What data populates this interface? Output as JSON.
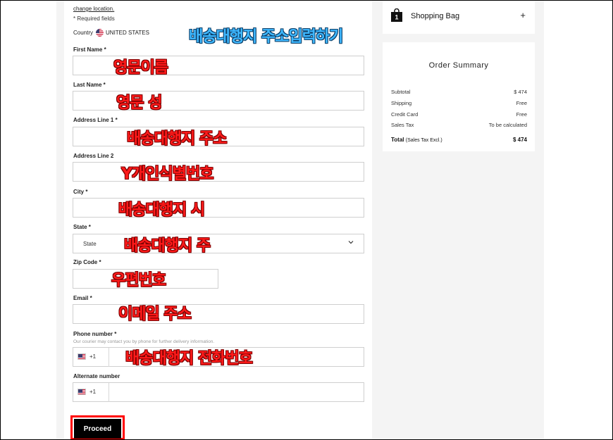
{
  "top": {
    "change_location": "change location.",
    "required_note": "* Required fields",
    "country_label": "Country",
    "country_value": "UNITED STATES"
  },
  "annotation_title": "배송대행지 주소입력하기",
  "fields": {
    "first_name": {
      "label": "First Name *",
      "note": "영문이름"
    },
    "last_name": {
      "label": "Last Name *",
      "note": "영문 성"
    },
    "address1": {
      "label": "Address Line 1 *",
      "note": "배송대행지 주소"
    },
    "address2": {
      "label": "Address Line 2",
      "note": "Y개인식별번호"
    },
    "city": {
      "label": "City *",
      "note": "배송대행지 시"
    },
    "state": {
      "label": "State *",
      "value": "State",
      "note": "배송대행지 주"
    },
    "zip": {
      "label": "Zip Code *",
      "note": "우편번호"
    },
    "email": {
      "label": "Email *",
      "note": "이메일 주소"
    },
    "phone": {
      "label": "Phone number *",
      "courier_note": "Our courier may contact you by phone for further delivery information.",
      "prefix": "+1",
      "note": "배송대행지 전화번호"
    },
    "alternate": {
      "label": "Alternate number",
      "prefix": "+1"
    }
  },
  "proceed_label": "Proceed",
  "bag": {
    "title": "Shopping Bag",
    "count": "1",
    "toggle": "+"
  },
  "summary": {
    "title": "Order Summary",
    "rows": [
      {
        "label": "Subtotal",
        "value": "$ 474"
      },
      {
        "label": "Shipping",
        "value": "Free"
      },
      {
        "label": "Credit Card",
        "value": "Free"
      },
      {
        "label": "Sales Tax",
        "value": "To be calculated"
      }
    ],
    "total_label": "Total",
    "total_sub": "(Sales Tax Excl.)",
    "total_value": "$ 474"
  },
  "icons": {
    "bag": "shopping-bag-icon",
    "chevron": "chevron-down-icon",
    "flag": "us-flag-icon"
  }
}
